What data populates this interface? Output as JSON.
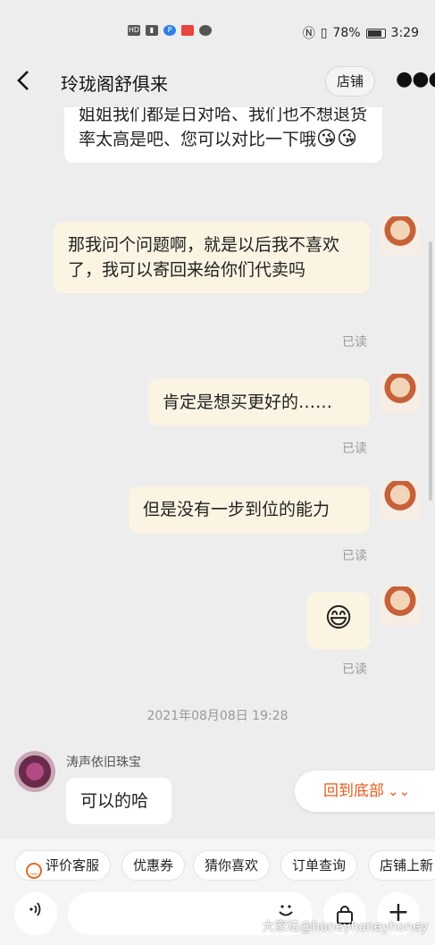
{
  "status_bar": {
    "battery": "78%",
    "time": "3:29",
    "left_icons": [
      "hd-icon",
      "signal-icon",
      "app-icon-blue",
      "app-icon-red",
      "chat-icon"
    ],
    "right_icons": [
      "nfc-icon",
      "vibrate-icon",
      "battery-icon"
    ]
  },
  "header": {
    "back_icon": "chevron-left-icon",
    "title": "玲珑阁舒俱来",
    "shop_button": "店铺",
    "more_icon": "more-icon"
  },
  "messages": [
    {
      "direction": "in",
      "text": "姐姐我们都是日对哈、我们也不想退货率太高是吧、您可以对比一下哦",
      "emoji": "😘😘"
    },
    {
      "direction": "out",
      "text": "那我问个问题啊，就是以后我不喜欢了，我可以寄回来给你们代卖吗",
      "status": "已读"
    },
    {
      "direction": "out",
      "text": "肯定是想买更好的……",
      "status": "已读"
    },
    {
      "direction": "out",
      "text": "但是没有一步到位的能力",
      "status": "已读"
    },
    {
      "direction": "out",
      "text": "",
      "emoji": "😄",
      "status": "已读"
    }
  ],
  "timestamp": "2021年08月08日 19:28",
  "incoming": {
    "sender": "涛声依旧珠宝",
    "text": "可以的哈"
  },
  "scroll_to_bottom": "回到底部",
  "quick_chips": [
    "评价客服",
    "优惠券",
    "猜你喜欢",
    "订单查询",
    "店铺上新"
  ],
  "input": {
    "placeholder": "",
    "voice_icon": "voice-icon",
    "emoji_icon": "emoji-icon",
    "bag_icon": "shopping-bag-icon",
    "plus_icon": "plus-icon"
  },
  "watermark": "大家坛@honeyhoneyhoney",
  "colors": {
    "accent": "#e85a1a",
    "outgoing_bubble": "#fbf4e3",
    "incoming_bubble": "#ffffff",
    "background": "#ededed"
  }
}
